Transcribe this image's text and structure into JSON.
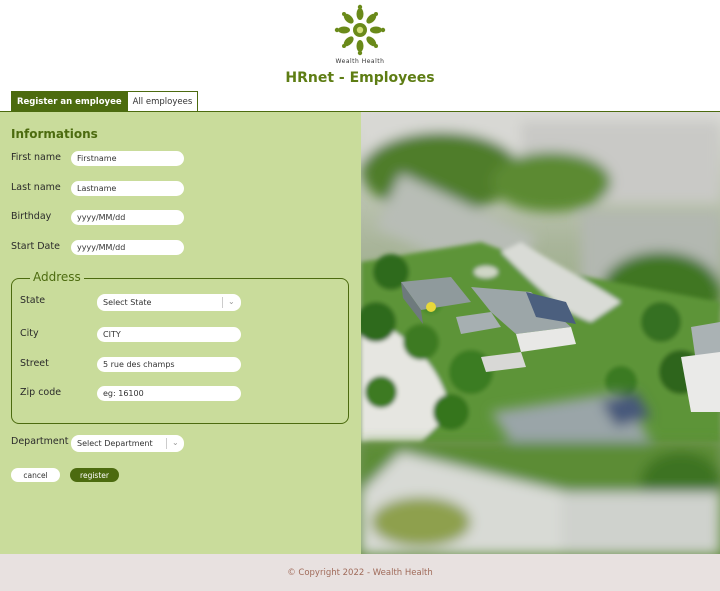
{
  "header": {
    "brand": "Wealth Health",
    "title": "HRnet - Employees"
  },
  "tabs": [
    {
      "label": "Register an employee",
      "active": true
    },
    {
      "label": "All employees",
      "active": false
    }
  ],
  "form": {
    "section_title": "Informations",
    "first_name": {
      "label": "First name",
      "placeholder": "Firstname"
    },
    "last_name": {
      "label": "Last name",
      "placeholder": "Lastname"
    },
    "birthday": {
      "label": "Birthday",
      "placeholder": "yyyy/MM/dd"
    },
    "start_date": {
      "label": "Start Date",
      "placeholder": "yyyy/MM/dd"
    },
    "address": {
      "legend": "Address",
      "state": {
        "label": "State",
        "placeholder": "Select State"
      },
      "city": {
        "label": "City",
        "placeholder": "CITY"
      },
      "street": {
        "label": "Street",
        "placeholder": "5 rue des champs"
      },
      "zip": {
        "label": "Zip code",
        "placeholder": "eg: 16100"
      }
    },
    "department": {
      "label": "Department",
      "placeholder": "Select Department"
    },
    "cancel_label": "cancel",
    "register_label": "register"
  },
  "footer": {
    "copyright": "© Copyright 2022 - Wealth Health"
  },
  "colors": {
    "accent": "#4c6b0f",
    "title": "#5e7d14",
    "panel": "#c9dc9b",
    "footer_bg": "#e8e1e0",
    "footer_text": "#a06b5a"
  },
  "icons": [
    "wealth-health-logo",
    "chevron-down-icon"
  ]
}
